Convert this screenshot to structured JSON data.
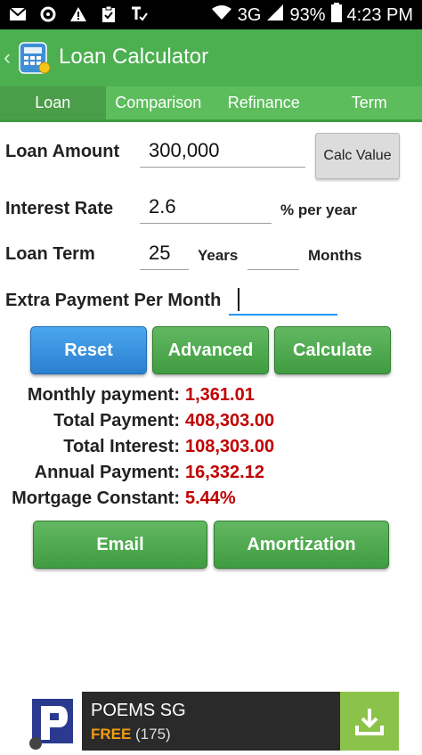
{
  "status_bar": {
    "network": "3G",
    "battery": "93%",
    "time": "4:23 PM",
    "icons": [
      "gmail-icon",
      "sync-icon",
      "warning-icon",
      "clipboard-icon",
      "tasks-icon",
      "wifi-icon",
      "signal-icon",
      "battery-icon"
    ]
  },
  "app_bar": {
    "title": "Loan Calculator"
  },
  "tabs": [
    {
      "label": "Loan",
      "active": true
    },
    {
      "label": "Comparison",
      "active": false
    },
    {
      "label": "Refinance",
      "active": false
    },
    {
      "label": "Term",
      "active": false
    }
  ],
  "form": {
    "loan_amount_label": "Loan Amount",
    "loan_amount_value": "300,000",
    "calc_value_button": "Calc Value",
    "interest_rate_label": "Interest Rate",
    "interest_rate_value": "2.6",
    "interest_unit": "% per year",
    "loan_term_label": "Loan Term",
    "loan_term_years_value": "25",
    "years_unit": "Years",
    "loan_term_months_value": "",
    "months_unit": "Months",
    "extra_payment_label": "Extra Payment Per Month",
    "extra_payment_value": ""
  },
  "actions": {
    "reset": "Reset",
    "advanced": "Advanced",
    "calculate": "Calculate",
    "email": "Email",
    "amortization": "Amortization"
  },
  "results": [
    {
      "label": "Monthly payment:",
      "value": "1,361.01"
    },
    {
      "label": "Total Payment:",
      "value": "408,303.00"
    },
    {
      "label": "Total Interest:",
      "value": "108,303.00"
    },
    {
      "label": "Annual Payment:",
      "value": "16,332.12"
    },
    {
      "label": "Mortgage Constant:",
      "value": "5.44%"
    }
  ],
  "ad": {
    "title": "POEMS SG",
    "price": "FREE",
    "reviews": "(175)"
  },
  "colors": {
    "primary_green": "#4caf50",
    "value_red": "#c00000",
    "reset_blue": "#2b7fd0"
  }
}
